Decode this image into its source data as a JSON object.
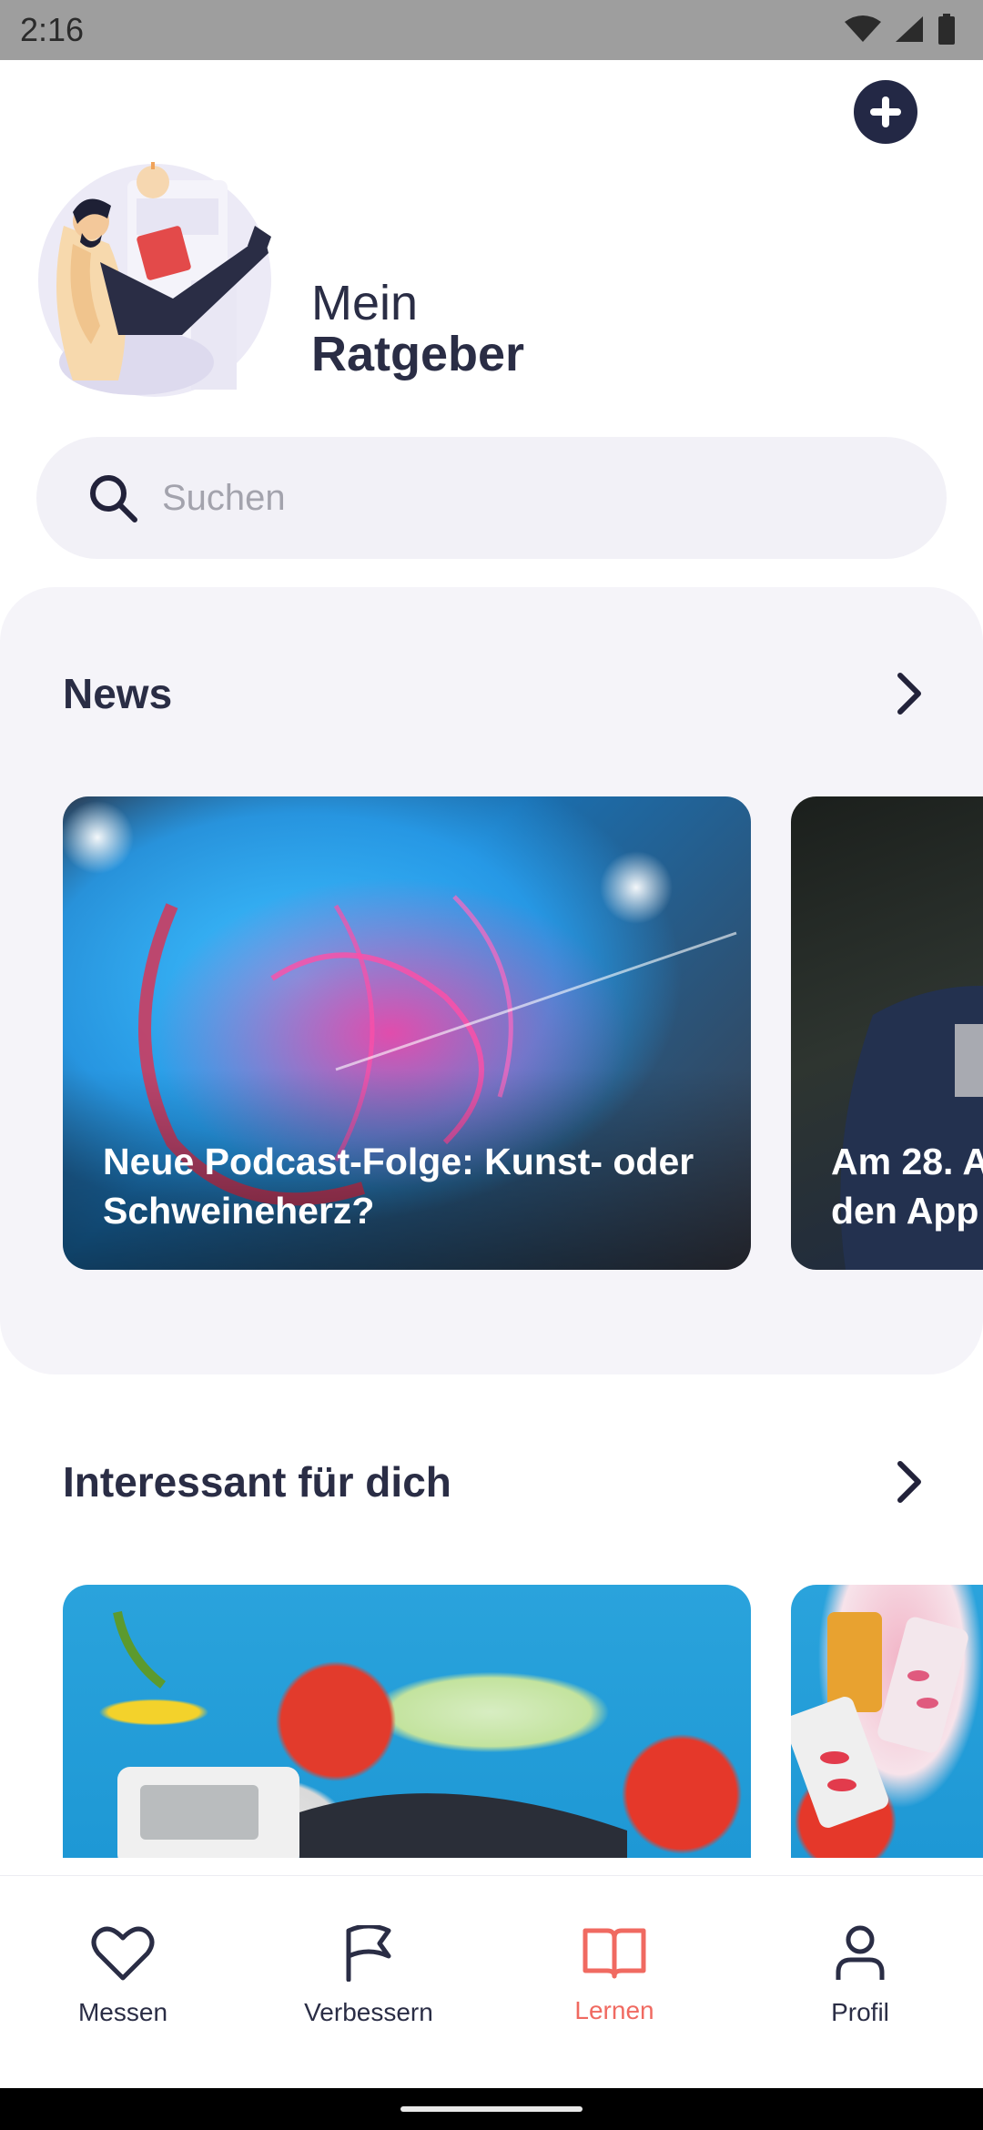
{
  "status_bar": {
    "time": "2:16"
  },
  "header": {
    "title_line1": "Mein",
    "title_line2": "Ratgeber"
  },
  "search": {
    "placeholder": "Suchen",
    "value": ""
  },
  "news": {
    "title": "News",
    "cards": [
      {
        "title": "Neue Podcast-Folge: Kunst- oder\nSchweineherz?"
      },
      {
        "title": "Am 28. A\nden App"
      }
    ]
  },
  "interesting": {
    "title": "Interessant für dich"
  },
  "nav": {
    "active_color": "#f06a61",
    "items": [
      {
        "label": "Messen",
        "icon": "heart-icon"
      },
      {
        "label": "Verbessern",
        "icon": "flag-icon"
      },
      {
        "label": "Lernen",
        "icon": "book-icon"
      },
      {
        "label": "Profil",
        "icon": "person-icon"
      }
    ]
  }
}
